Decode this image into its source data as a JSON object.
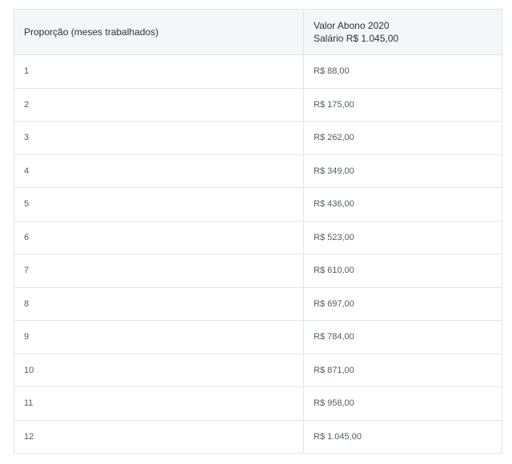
{
  "table": {
    "header": {
      "col1": "Proporção (meses trabalhados)",
      "col2_line1": "Valor Abono 2020",
      "col2_line2": "Salário R$ 1.045,00"
    },
    "rows": [
      {
        "months": "1",
        "value": "R$ 88,00"
      },
      {
        "months": "2",
        "value": "R$ 175,00"
      },
      {
        "months": "3",
        "value": "R$ 262,00"
      },
      {
        "months": "4",
        "value": "R$ 349,00"
      },
      {
        "months": "5",
        "value": "R$ 436,00"
      },
      {
        "months": "6",
        "value": "R$ 523,00"
      },
      {
        "months": "7",
        "value": "R$ 610,00"
      },
      {
        "months": "8",
        "value": "R$ 697,00"
      },
      {
        "months": "9",
        "value": "R$ 784,00"
      },
      {
        "months": "10",
        "value": "R$ 871,00"
      },
      {
        "months": "11",
        "value": "R$ 958,00"
      },
      {
        "months": "12",
        "value": "R$ 1.045,00"
      }
    ]
  }
}
